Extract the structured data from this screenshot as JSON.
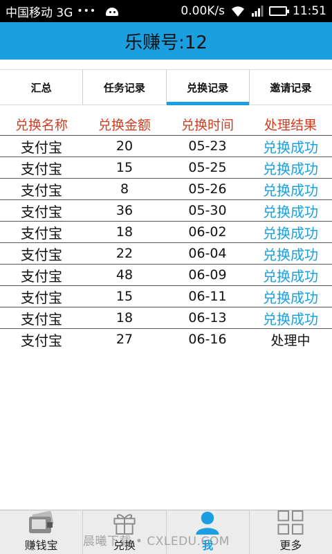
{
  "status_bar": {
    "carrier": "中国移动 3G",
    "dots": "•••",
    "speed": "0.00K/s",
    "time": "11:51"
  },
  "header": {
    "title": "乐赚号:12"
  },
  "tabs": [
    {
      "label": "汇总",
      "active": false
    },
    {
      "label": "任务记录",
      "active": false
    },
    {
      "label": "兑换记录",
      "active": true
    },
    {
      "label": "邀请记录",
      "active": false
    }
  ],
  "table": {
    "headers": [
      "兑换名称",
      "兑换金额",
      "兑换时间",
      "处理结果"
    ],
    "rows": [
      {
        "name": "支付宝",
        "amount": "20",
        "date": "05-23",
        "result": "兑换成功"
      },
      {
        "name": "支付宝",
        "amount": "15",
        "date": "05-25",
        "result": "兑换成功"
      },
      {
        "name": "支付宝",
        "amount": "8",
        "date": "05-26",
        "result": "兑换成功"
      },
      {
        "name": "支付宝",
        "amount": "36",
        "date": "05-30",
        "result": "兑换成功"
      },
      {
        "name": "支付宝",
        "amount": "18",
        "date": "06-02",
        "result": "兑换成功"
      },
      {
        "name": "支付宝",
        "amount": "22",
        "date": "06-04",
        "result": "兑换成功"
      },
      {
        "name": "支付宝",
        "amount": "48",
        "date": "06-09",
        "result": "兑换成功"
      },
      {
        "name": "支付宝",
        "amount": "15",
        "date": "06-11",
        "result": "兑换成功"
      },
      {
        "name": "支付宝",
        "amount": "18",
        "date": "06-13",
        "result": "兑换成功"
      },
      {
        "name": "支付宝",
        "amount": "27",
        "date": "06-16",
        "result": "处理中"
      }
    ]
  },
  "bottom_nav": [
    {
      "label": "赚钱宝",
      "icon": "wallet-icon",
      "active": false
    },
    {
      "label": "兑换",
      "icon": "gift-icon",
      "active": false
    },
    {
      "label": "我",
      "icon": "user-icon",
      "active": true
    },
    {
      "label": "更多",
      "icon": "grid-icon",
      "active": false
    }
  ],
  "watermark": "晨曦下载 • CXLEDU.COM",
  "colors": {
    "accent": "#1a9fe0",
    "header_red": "#d23c1e"
  }
}
